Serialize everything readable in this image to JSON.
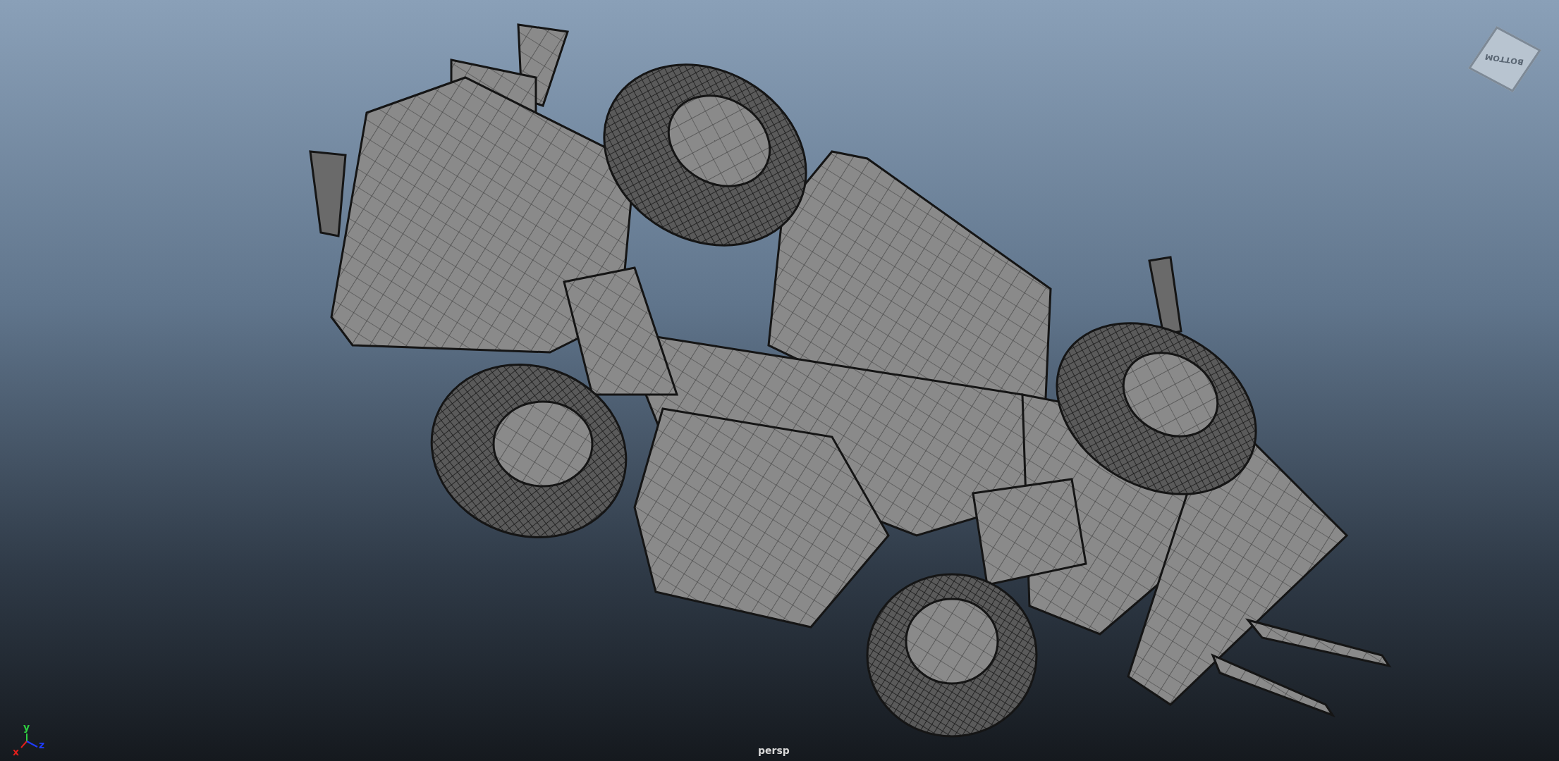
{
  "viewport": {
    "camera_label": "persp",
    "view_cube": {
      "face_label": "BOTTOM"
    },
    "axis_gizmo": {
      "labels": [
        "x",
        "y",
        "z"
      ]
    }
  }
}
